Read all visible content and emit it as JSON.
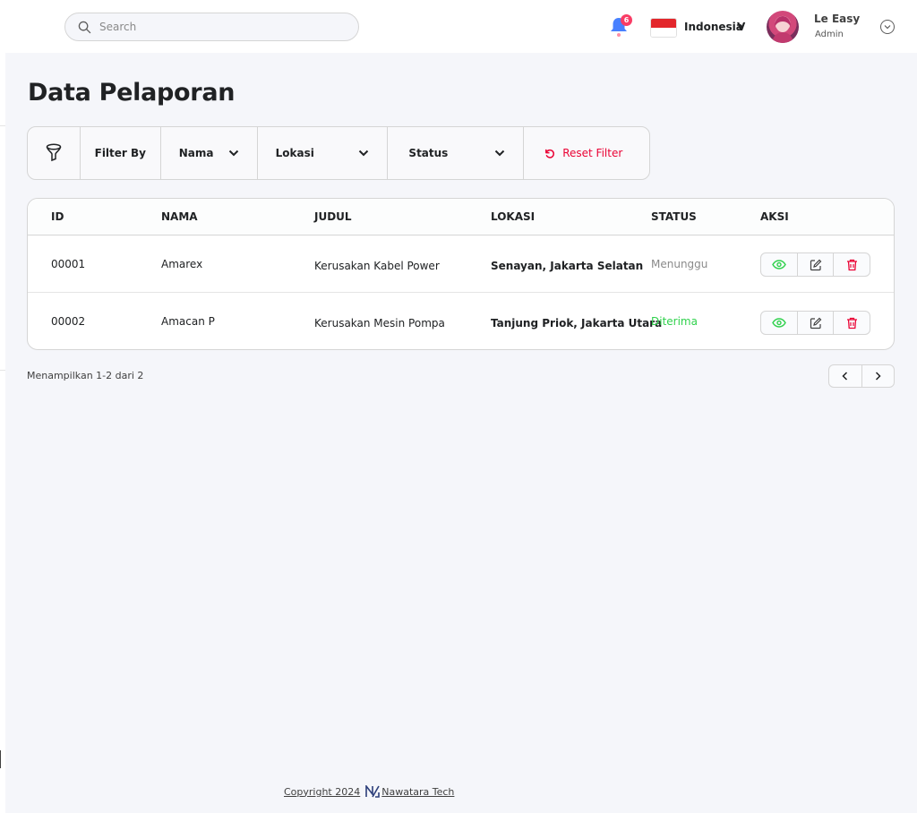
{
  "header": {
    "search_placeholder": "Search",
    "notification_count": "6",
    "language": "Indonesia",
    "language_toggle": "V",
    "user_name": "Le Easy",
    "user_role": "Admin"
  },
  "page": {
    "title": "Data Pelaporan"
  },
  "filter": {
    "filter_by_label": "Filter By",
    "name_label": "Nama",
    "location_label": "Lokasi",
    "status_label": "Status",
    "reset_label": "Reset Filter"
  },
  "table": {
    "headers": [
      "ID",
      "NAMA",
      "JUDUL",
      "LOKASI",
      "STATUS",
      "AKSI"
    ],
    "rows": [
      {
        "id": "00001",
        "nama": "Amarex",
        "judul": "Kerusakan Kabel Power",
        "lokasi": "Senayan, Jakarta Selatan",
        "status": "Menunggu"
      },
      {
        "id": "00002",
        "nama": "Amacan P",
        "judul": "Kerusakan Mesin Pompa",
        "lokasi": "Tanjung Priok, Jakarta Utara",
        "status": "Diterima"
      }
    ]
  },
  "pagination": {
    "summary": "Menampilkan 1-2 dari  2"
  },
  "footer": {
    "copyright": "Copyright 2024",
    "brand": "Nawatara Tech"
  },
  "colors": {
    "accent_red": "#ea0234",
    "status_waiting": "#8a8a8a",
    "status_accepted": "#2fd14c",
    "view_icon": "#2fd14c",
    "delete_icon": "#ea0234",
    "notification_blue": "#4880ff",
    "badge": "#f93c65"
  }
}
